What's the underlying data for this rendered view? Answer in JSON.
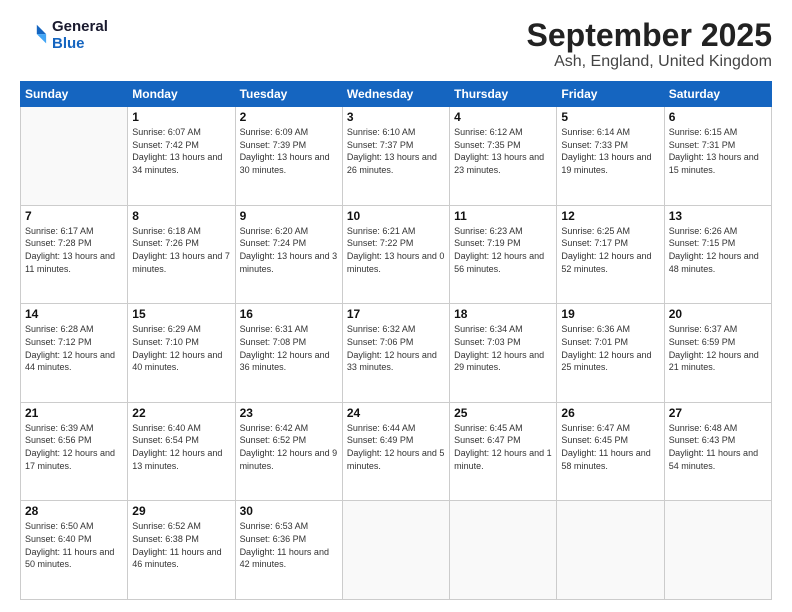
{
  "header": {
    "logo_line1": "General",
    "logo_line2": "Blue",
    "month": "September 2025",
    "location": "Ash, England, United Kingdom"
  },
  "weekdays": [
    "Sunday",
    "Monday",
    "Tuesday",
    "Wednesday",
    "Thursday",
    "Friday",
    "Saturday"
  ],
  "weeks": [
    [
      {
        "day": "",
        "sunrise": "",
        "sunset": "",
        "daylight": ""
      },
      {
        "day": "1",
        "sunrise": "Sunrise: 6:07 AM",
        "sunset": "Sunset: 7:42 PM",
        "daylight": "Daylight: 13 hours and 34 minutes."
      },
      {
        "day": "2",
        "sunrise": "Sunrise: 6:09 AM",
        "sunset": "Sunset: 7:39 PM",
        "daylight": "Daylight: 13 hours and 30 minutes."
      },
      {
        "day": "3",
        "sunrise": "Sunrise: 6:10 AM",
        "sunset": "Sunset: 7:37 PM",
        "daylight": "Daylight: 13 hours and 26 minutes."
      },
      {
        "day": "4",
        "sunrise": "Sunrise: 6:12 AM",
        "sunset": "Sunset: 7:35 PM",
        "daylight": "Daylight: 13 hours and 23 minutes."
      },
      {
        "day": "5",
        "sunrise": "Sunrise: 6:14 AM",
        "sunset": "Sunset: 7:33 PM",
        "daylight": "Daylight: 13 hours and 19 minutes."
      },
      {
        "day": "6",
        "sunrise": "Sunrise: 6:15 AM",
        "sunset": "Sunset: 7:31 PM",
        "daylight": "Daylight: 13 hours and 15 minutes."
      }
    ],
    [
      {
        "day": "7",
        "sunrise": "Sunrise: 6:17 AM",
        "sunset": "Sunset: 7:28 PM",
        "daylight": "Daylight: 13 hours and 11 minutes."
      },
      {
        "day": "8",
        "sunrise": "Sunrise: 6:18 AM",
        "sunset": "Sunset: 7:26 PM",
        "daylight": "Daylight: 13 hours and 7 minutes."
      },
      {
        "day": "9",
        "sunrise": "Sunrise: 6:20 AM",
        "sunset": "Sunset: 7:24 PM",
        "daylight": "Daylight: 13 hours and 3 minutes."
      },
      {
        "day": "10",
        "sunrise": "Sunrise: 6:21 AM",
        "sunset": "Sunset: 7:22 PM",
        "daylight": "Daylight: 13 hours and 0 minutes."
      },
      {
        "day": "11",
        "sunrise": "Sunrise: 6:23 AM",
        "sunset": "Sunset: 7:19 PM",
        "daylight": "Daylight: 12 hours and 56 minutes."
      },
      {
        "day": "12",
        "sunrise": "Sunrise: 6:25 AM",
        "sunset": "Sunset: 7:17 PM",
        "daylight": "Daylight: 12 hours and 52 minutes."
      },
      {
        "day": "13",
        "sunrise": "Sunrise: 6:26 AM",
        "sunset": "Sunset: 7:15 PM",
        "daylight": "Daylight: 12 hours and 48 minutes."
      }
    ],
    [
      {
        "day": "14",
        "sunrise": "Sunrise: 6:28 AM",
        "sunset": "Sunset: 7:12 PM",
        "daylight": "Daylight: 12 hours and 44 minutes."
      },
      {
        "day": "15",
        "sunrise": "Sunrise: 6:29 AM",
        "sunset": "Sunset: 7:10 PM",
        "daylight": "Daylight: 12 hours and 40 minutes."
      },
      {
        "day": "16",
        "sunrise": "Sunrise: 6:31 AM",
        "sunset": "Sunset: 7:08 PM",
        "daylight": "Daylight: 12 hours and 36 minutes."
      },
      {
        "day": "17",
        "sunrise": "Sunrise: 6:32 AM",
        "sunset": "Sunset: 7:06 PM",
        "daylight": "Daylight: 12 hours and 33 minutes."
      },
      {
        "day": "18",
        "sunrise": "Sunrise: 6:34 AM",
        "sunset": "Sunset: 7:03 PM",
        "daylight": "Daylight: 12 hours and 29 minutes."
      },
      {
        "day": "19",
        "sunrise": "Sunrise: 6:36 AM",
        "sunset": "Sunset: 7:01 PM",
        "daylight": "Daylight: 12 hours and 25 minutes."
      },
      {
        "day": "20",
        "sunrise": "Sunrise: 6:37 AM",
        "sunset": "Sunset: 6:59 PM",
        "daylight": "Daylight: 12 hours and 21 minutes."
      }
    ],
    [
      {
        "day": "21",
        "sunrise": "Sunrise: 6:39 AM",
        "sunset": "Sunset: 6:56 PM",
        "daylight": "Daylight: 12 hours and 17 minutes."
      },
      {
        "day": "22",
        "sunrise": "Sunrise: 6:40 AM",
        "sunset": "Sunset: 6:54 PM",
        "daylight": "Daylight: 12 hours and 13 minutes."
      },
      {
        "day": "23",
        "sunrise": "Sunrise: 6:42 AM",
        "sunset": "Sunset: 6:52 PM",
        "daylight": "Daylight: 12 hours and 9 minutes."
      },
      {
        "day": "24",
        "sunrise": "Sunrise: 6:44 AM",
        "sunset": "Sunset: 6:49 PM",
        "daylight": "Daylight: 12 hours and 5 minutes."
      },
      {
        "day": "25",
        "sunrise": "Sunrise: 6:45 AM",
        "sunset": "Sunset: 6:47 PM",
        "daylight": "Daylight: 12 hours and 1 minute."
      },
      {
        "day": "26",
        "sunrise": "Sunrise: 6:47 AM",
        "sunset": "Sunset: 6:45 PM",
        "daylight": "Daylight: 11 hours and 58 minutes."
      },
      {
        "day": "27",
        "sunrise": "Sunrise: 6:48 AM",
        "sunset": "Sunset: 6:43 PM",
        "daylight": "Daylight: 11 hours and 54 minutes."
      }
    ],
    [
      {
        "day": "28",
        "sunrise": "Sunrise: 6:50 AM",
        "sunset": "Sunset: 6:40 PM",
        "daylight": "Daylight: 11 hours and 50 minutes."
      },
      {
        "day": "29",
        "sunrise": "Sunrise: 6:52 AM",
        "sunset": "Sunset: 6:38 PM",
        "daylight": "Daylight: 11 hours and 46 minutes."
      },
      {
        "day": "30",
        "sunrise": "Sunrise: 6:53 AM",
        "sunset": "Sunset: 6:36 PM",
        "daylight": "Daylight: 11 hours and 42 minutes."
      },
      {
        "day": "",
        "sunrise": "",
        "sunset": "",
        "daylight": ""
      },
      {
        "day": "",
        "sunrise": "",
        "sunset": "",
        "daylight": ""
      },
      {
        "day": "",
        "sunrise": "",
        "sunset": "",
        "daylight": ""
      },
      {
        "day": "",
        "sunrise": "",
        "sunset": "",
        "daylight": ""
      }
    ]
  ]
}
